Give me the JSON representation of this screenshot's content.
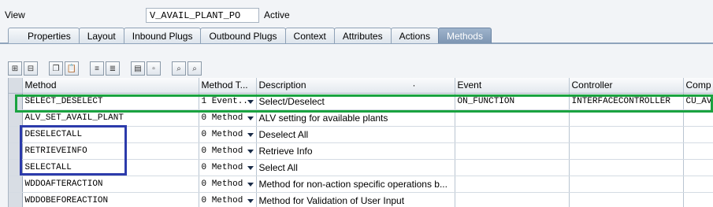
{
  "view": {
    "label": "View",
    "name": "V_AVAIL_PLANT_PO",
    "status": "Active"
  },
  "tabs": [
    {
      "label": "Properties",
      "active": false
    },
    {
      "label": "Layout",
      "active": false
    },
    {
      "label": "Inbound Plugs",
      "active": false
    },
    {
      "label": "Outbound Plugs",
      "active": false
    },
    {
      "label": "Context",
      "active": false
    },
    {
      "label": "Attributes",
      "active": false
    },
    {
      "label": "Actions",
      "active": false
    },
    {
      "label": "Methods",
      "active": true
    }
  ],
  "table": {
    "columns": [
      "Method",
      "Method T...",
      "Description",
      "Event",
      "Controller",
      "Comp"
    ],
    "description_header_dot": "·",
    "rows": [
      {
        "method": "SELECT_DESELECT",
        "type": "1 Event...",
        "description": "Select/Deselect",
        "event": "ON_FUNCTION",
        "controller": "INTERFACECONTROLLER",
        "comp": "CU_AV"
      },
      {
        "method": "ALV_SET_AVAIL_PLANT",
        "type": "0 Method",
        "description": "ALV setting for available plants",
        "event": "",
        "controller": "",
        "comp": ""
      },
      {
        "method": "DESELECTALL",
        "type": "0 Method",
        "description": "Deselect All",
        "event": "",
        "controller": "",
        "comp": ""
      },
      {
        "method": "RETRIEVEINFO",
        "type": "0 Method",
        "description": "Retrieve Info",
        "event": "",
        "controller": "",
        "comp": ""
      },
      {
        "method": "SELECTALL",
        "type": "0 Method",
        "description": "Select All",
        "event": "",
        "controller": "",
        "comp": ""
      },
      {
        "method": "WDDOAFTERACTION",
        "type": "0 Method",
        "description": "Method for non-action specific operations b...",
        "event": "",
        "controller": "",
        "comp": ""
      },
      {
        "method": "WDDOBEFOREACTION",
        "type": "0 Method",
        "description": "Method for Validation of User Input",
        "event": "",
        "controller": "",
        "comp": ""
      }
    ]
  },
  "colors": {
    "highlight_green": "#1aa340",
    "highlight_blue": "#2c3bab",
    "active_tab": "#8aa2bf"
  }
}
